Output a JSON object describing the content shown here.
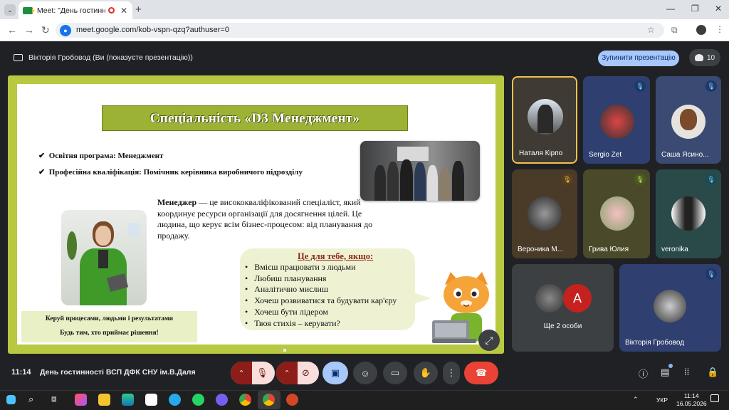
{
  "browser": {
    "tab_title": "Meet: \"День гостинності В",
    "tab_close": "✕",
    "new_tab": "+",
    "url": "meet.google.com/kob-vspn-qzq?authuser=0",
    "window_min": "—",
    "window_max": "❐",
    "window_close": "✕"
  },
  "meet": {
    "presenter_banner": "Вікторія Гробовод (Ви (показуєте презентацію))",
    "stop_presenting": "Зупинити презентацію",
    "participant_count": "10",
    "time": "11:14",
    "meeting_name": "День гостинності ВСП ДФК СНУ ім.В.Даля"
  },
  "slide": {
    "title": "Спеціальність «D3 Менеджмент»",
    "bullets": [
      "Освітня програма: Менеджмент",
      "Професійна кваліфікація: Помічник керівника виробничого підрозділу"
    ],
    "manager_term": "Менеджер",
    "manager_text": " — це висококваліфікований спеціаліст, який координує ресурси організації для досягнення цілей. Це людина, що керує всім бізнес-процесом: від планування до продажу.",
    "caption_line1": "Керуй процесами, людьми і результатами",
    "caption_line2": "Будь тим, хто приймає рішення!",
    "bubble_title": "Це для тебе, якщо:",
    "bubble_items": [
      "Вмієш працювати з людьми",
      "Любиш планування",
      "Аналітично мислиш",
      "Хочеш розвиватися та будувати кар'єру",
      "Хочеш бути лідером",
      "Твоя стихія – керувати?"
    ]
  },
  "participants": [
    {
      "name": "Наталя Кірпо",
      "muted": false
    },
    {
      "name": "Sergio Zet",
      "muted": true
    },
    {
      "name": "Саша Ясино...",
      "muted": true
    },
    {
      "name": "Вероника М...",
      "muted": true
    },
    {
      "name": "Грива Юлия",
      "muted": true
    },
    {
      "name": "veronika",
      "muted": true
    },
    {
      "name": "Ще 2 особи",
      "extra_initial": "A"
    },
    {
      "name": "Вікторія Гробовод",
      "muted": true
    }
  ],
  "taskbar": {
    "language": "УКР",
    "clock_time": "11:14",
    "clock_date": "16.05.2026"
  },
  "colors": {
    "meet_bg": "#202124",
    "tile_bg": "#3c4043",
    "stop_btn": "#a8c7fa",
    "end_call": "#ea4335",
    "muted_ctl": "#f9dedc",
    "slide_frame": "#b8c840"
  },
  "icons": {
    "mic_off": "mic-off-icon",
    "cam_off": "camera-off-icon",
    "present": "present-icon",
    "emoji": "emoji-icon",
    "captions": "captions-icon",
    "raise_hand": "raise-hand-icon",
    "more": "more-vert-icon",
    "end_call": "end-call-icon"
  }
}
